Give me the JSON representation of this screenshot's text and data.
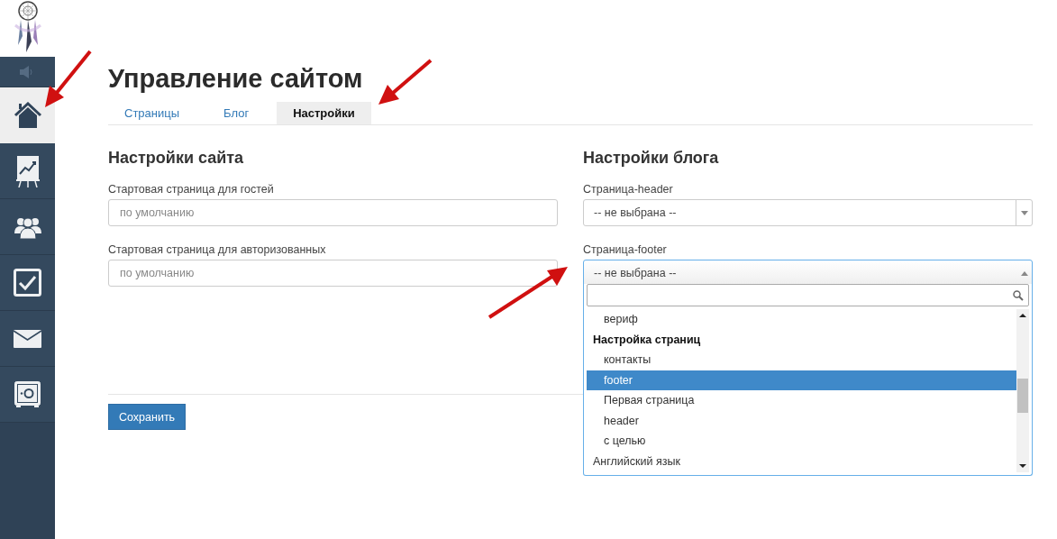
{
  "sidebar": {
    "items": [
      {
        "kind": "speaker",
        "selected": false
      },
      {
        "kind": "home",
        "selected": true
      },
      {
        "kind": "chart",
        "selected": false
      },
      {
        "kind": "people",
        "selected": false
      },
      {
        "kind": "check",
        "selected": false
      },
      {
        "kind": "mail",
        "selected": false
      },
      {
        "kind": "safe",
        "selected": false
      }
    ]
  },
  "title": "Управление сайтом",
  "tabs": [
    {
      "label": "Страницы",
      "selected": false
    },
    {
      "label": "Блог",
      "selected": false
    },
    {
      "label": "Настройки",
      "selected": true
    }
  ],
  "site_settings": {
    "heading": "Настройки сайта",
    "fields": [
      {
        "label": "Стартовая страница для гостей",
        "placeholder": "по умолчанию"
      },
      {
        "label": "Стартовая страница для авторизованных",
        "placeholder": "по умолчанию"
      }
    ]
  },
  "blog_settings": {
    "heading": "Настройки блога",
    "selects": [
      {
        "label": "Страница-header",
        "value": "-- не выбрана --",
        "expanded": false
      },
      {
        "label": "Страница-footer",
        "value": "-- не выбрана --",
        "expanded": true
      }
    ]
  },
  "dropdown": {
    "items": [
      {
        "kind": "child",
        "label": "вериф",
        "selected": false
      },
      {
        "kind": "group",
        "label": "Настройка страниц",
        "children": [
          {
            "label": "контакты",
            "selected": false
          },
          {
            "label": "footer",
            "selected": true
          },
          {
            "label": "Первая страница",
            "selected": false
          },
          {
            "label": "header",
            "selected": false
          },
          {
            "label": "с целью",
            "selected": false
          }
        ]
      },
      {
        "kind": "option",
        "label": "Английский язык",
        "selected": false
      }
    ]
  },
  "save_button": "Сохранить"
}
